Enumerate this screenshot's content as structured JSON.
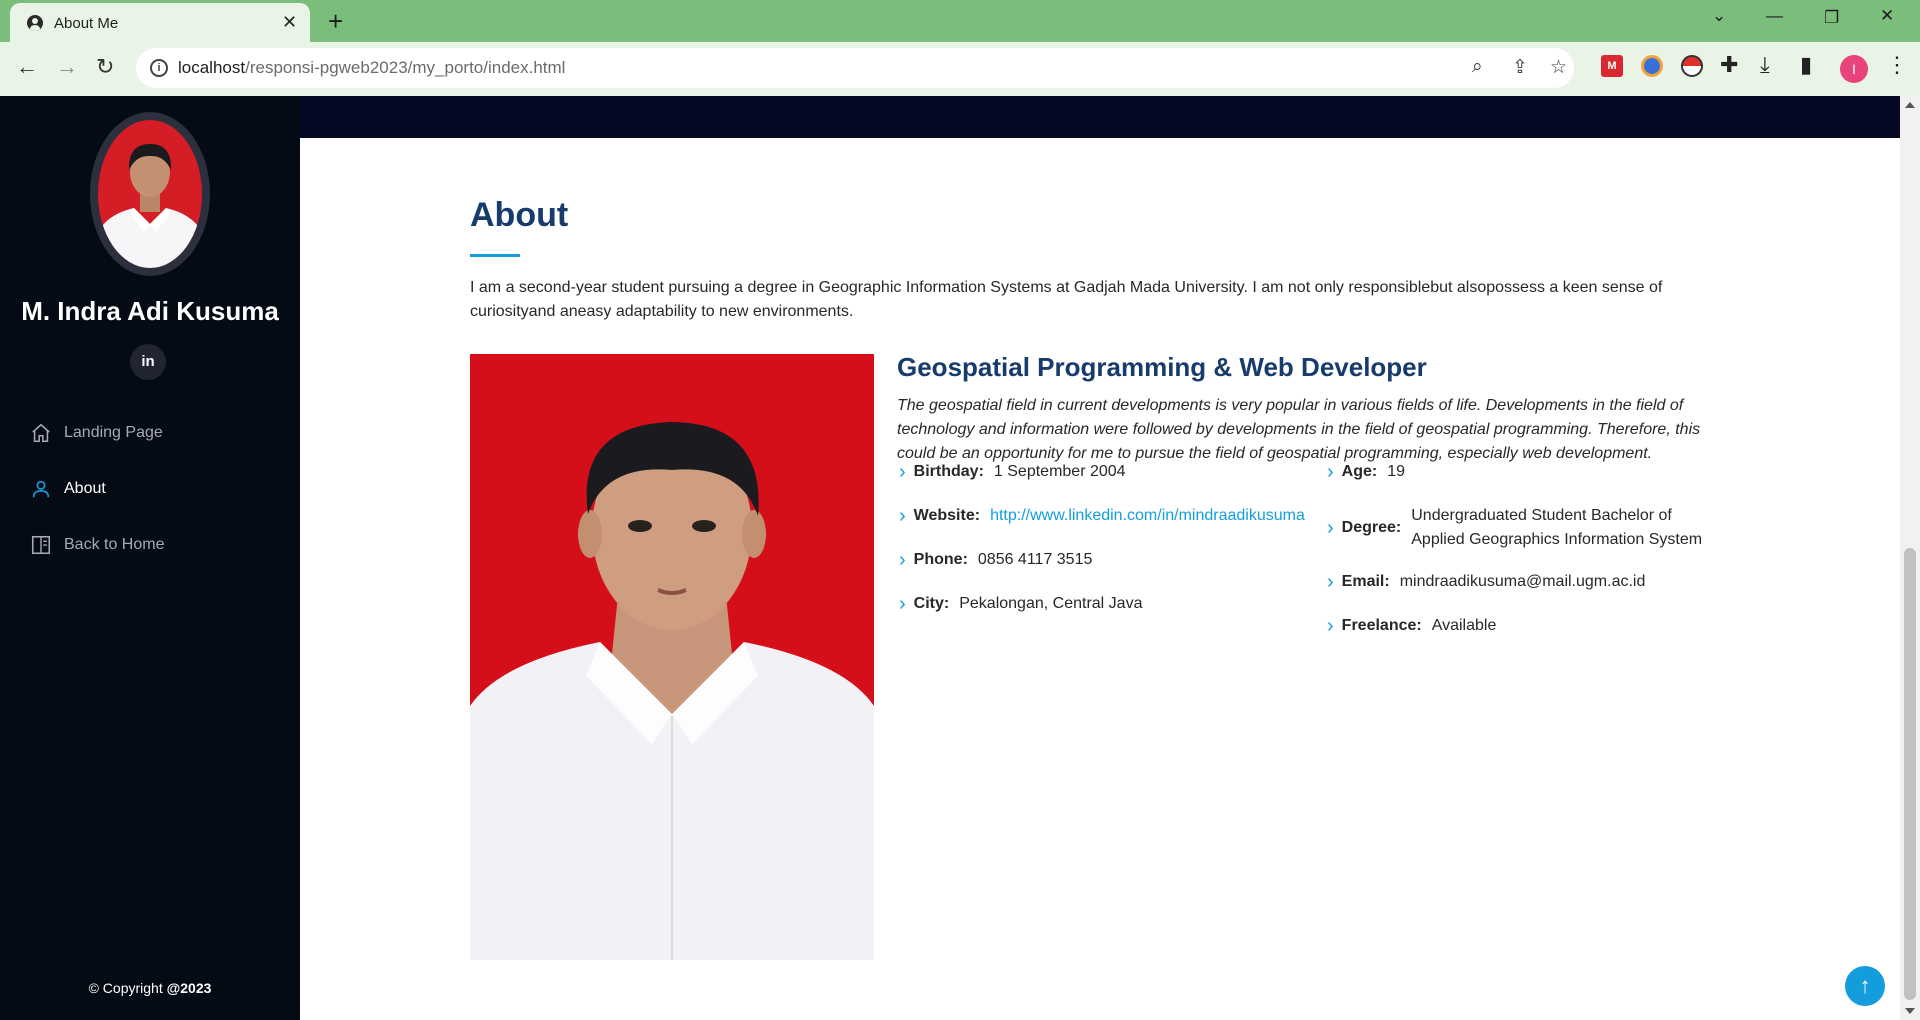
{
  "browser": {
    "tab_title": "About Me",
    "url_host": "localhost",
    "url_path": "/responsi-pgweb2023/my_porto/index.html",
    "profile_initial": "I",
    "ext_label": "M"
  },
  "sidebar": {
    "name": "M. Indra Adi Kusuma",
    "social_label": "in",
    "nav": [
      {
        "label": "Landing Page",
        "icon": "home-icon",
        "active": false
      },
      {
        "label": "About",
        "icon": "person-icon",
        "active": true
      },
      {
        "label": "Back to Home",
        "icon": "layout-icon",
        "active": false
      }
    ],
    "copyright_prefix": "© Copyright ",
    "copyright_year": "@2023"
  },
  "about": {
    "title": "About",
    "intro": "I am a second-year student pursuing a degree in Geographic Information Systems at Gadjah Mada University. I am not only responsiblebut alsopossess a keen sense of curiosityand aneasy adaptability to new environments.",
    "role": "Geospatial Programming & Web Developer",
    "role_desc": "The geospatial field in current developments is very popular in various fields of life. Developments in the field of technology and information were followed by developments in the field of geospatial programming. Therefore, this could be an opportunity for me to pursue the field of geospatial programming, especially web development.",
    "left_info": [
      {
        "key": "Birthday:",
        "value": "1 September 2004"
      },
      {
        "key": "Website:",
        "value": "http://www.linkedin.com/in/mindraadikusuma"
      },
      {
        "key": "Phone:",
        "value": "0856 4117 3515"
      },
      {
        "key": "City:",
        "value": "Pekalongan, Central Java"
      }
    ],
    "right_info": [
      {
        "key": "Age:",
        "value": "19"
      },
      {
        "key": "Degree:",
        "value_line1": "Undergraduated Student Bachelor of",
        "value_line2": "Applied Geographics Information System"
      },
      {
        "key": "Email:",
        "value": "mindraadikusuma@mail.ugm.ac.id"
      },
      {
        "key": "Freelance:",
        "value": "Available"
      }
    ]
  },
  "colors": {
    "accent": "#149ddd",
    "heading": "#173b6c",
    "sidebar_bg": "#040b14",
    "photo_bg": "#d40f1a",
    "chrome_green": "#7bbd7a"
  }
}
